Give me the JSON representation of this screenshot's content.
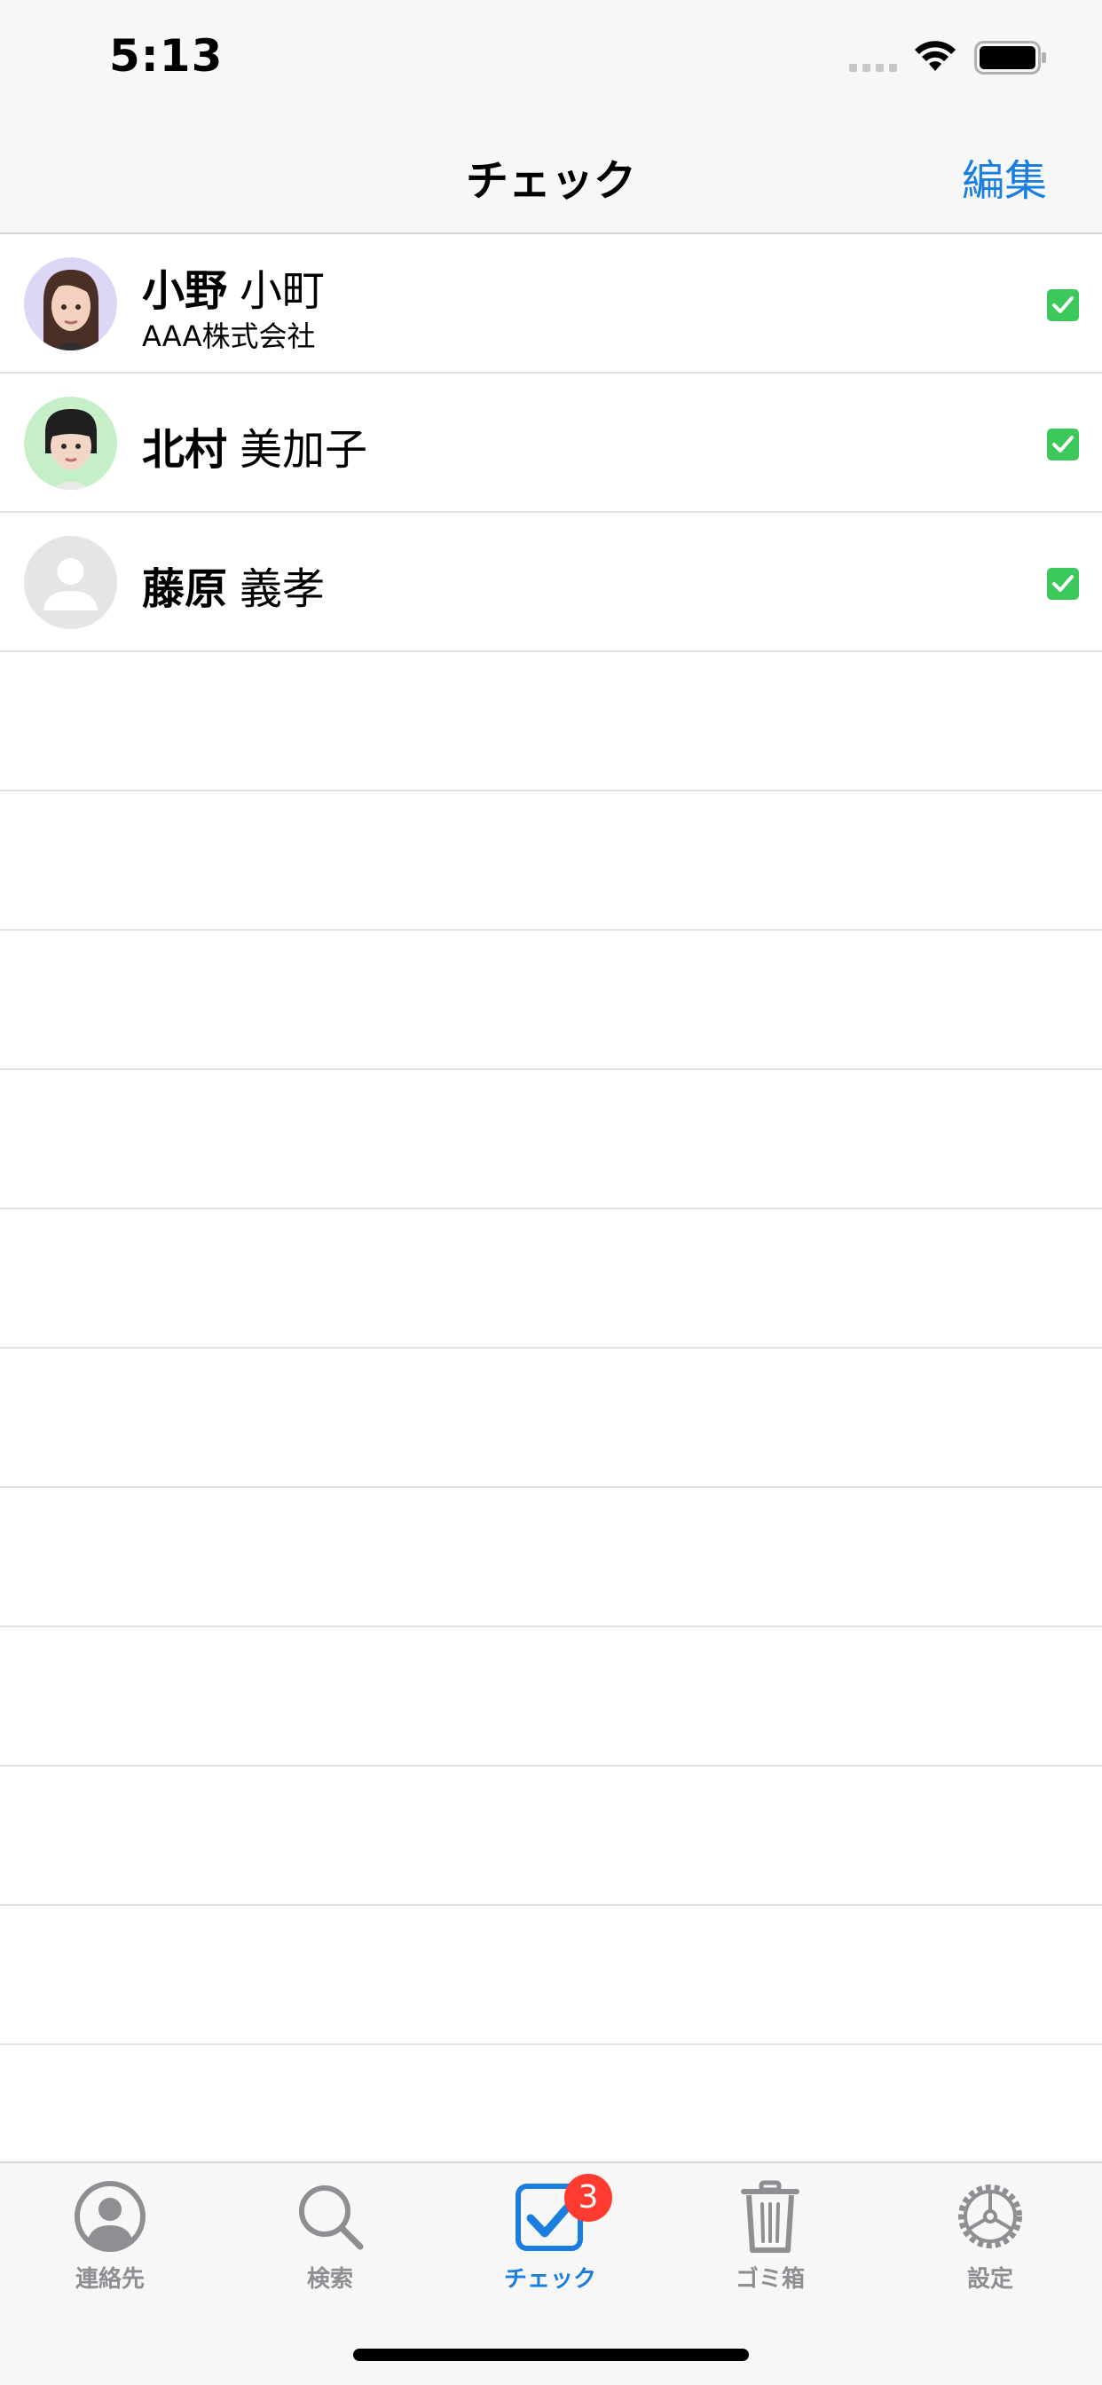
{
  "status_bar": {
    "time": "5:13"
  },
  "nav": {
    "title": "チェック",
    "edit_label": "編集"
  },
  "contacts": [
    {
      "family_name": "小野",
      "given_name": "小町",
      "company": "AAA株式会社",
      "checked": true,
      "avatar": "memoji-woman-long-hair"
    },
    {
      "family_name": "北村",
      "given_name": "美加子",
      "company": "",
      "checked": true,
      "avatar": "memoji-woman-bangs"
    },
    {
      "family_name": "藤原",
      "given_name": "義孝",
      "company": "",
      "checked": true,
      "avatar": "default-person"
    }
  ],
  "tabs": [
    {
      "label": "連絡先",
      "icon": "person-circle-icon",
      "active": false
    },
    {
      "label": "検索",
      "icon": "magnifier-icon",
      "active": false
    },
    {
      "label": "チェック",
      "icon": "checkbox-icon",
      "active": true,
      "badge": "3"
    },
    {
      "label": "ゴミ箱",
      "icon": "trash-icon",
      "active": false
    },
    {
      "label": "設定",
      "icon": "gear-icon",
      "active": false
    }
  ],
  "colors": {
    "accent": "#1a7de0",
    "check_green": "#3cc85a",
    "badge_red": "#ff3b30"
  }
}
